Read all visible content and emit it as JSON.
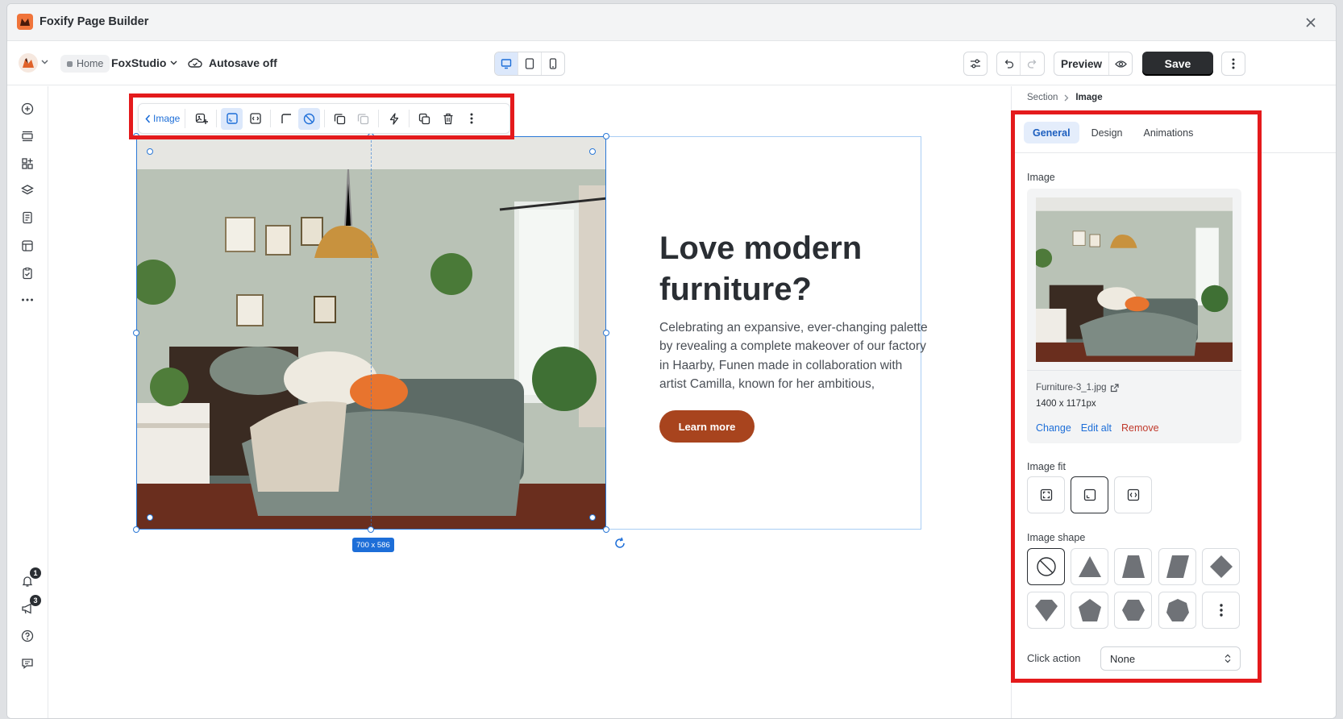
{
  "app": {
    "title": "Foxify Page Builder"
  },
  "header": {
    "breadcrumb_home": "Home",
    "store_name": "FoxStudio",
    "autosave": "Autosave off",
    "preview_label": "Preview",
    "save_label": "Save"
  },
  "toolbar": {
    "back_label": "Image"
  },
  "notifications": {
    "bell_count": "1",
    "announce_count": "3"
  },
  "canvas": {
    "size_label": "700 x 586",
    "headline_1": "Love modern",
    "headline_2": "furniture?",
    "paragraph": "Celebrating an expansive, ever-changing palette by revealing a complete makeover of our factory in Haarby, Funen made in collaboration with artist Camilla, known for her ambitious,",
    "button_label": "Learn more",
    "button_color": "#a8441e"
  },
  "panel": {
    "crumb_parent": "Section",
    "crumb_current": "Image",
    "tabs": [
      "General",
      "Design",
      "Animations"
    ],
    "active_tab": "General",
    "image_label": "Image",
    "file_name": "Furniture-3_1.jpg",
    "file_size": "1400 x 1171px",
    "change": "Change",
    "edit_alt": "Edit alt",
    "remove": "Remove",
    "fit_label": "Image fit",
    "shape_label": "Image shape",
    "click_action_label": "Click action",
    "click_action_value": "None"
  },
  "colors": {
    "accent": "#1d6ed8",
    "highlight": "#e41a1c",
    "save": "#2b2d30"
  }
}
